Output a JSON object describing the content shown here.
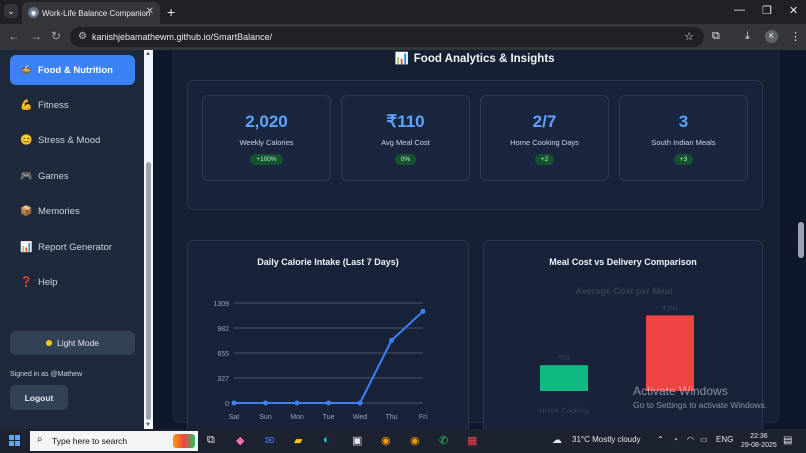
{
  "browser": {
    "tab_title": "Work-Life Balance Companion",
    "url": "kanishjebamathewm.github.io/SmartBalance/",
    "new_tab_symbol": "+",
    "close_tab_symbol": "✕"
  },
  "sidebar": {
    "items": [
      {
        "label": "Food & Nutrition",
        "icon": "food-icon",
        "glyph": "🍲",
        "active": true
      },
      {
        "label": "Fitness",
        "icon": "flexed-arm-icon",
        "glyph": "💪"
      },
      {
        "label": "Stress & Mood",
        "icon": "face-icon",
        "glyph": "😊"
      },
      {
        "label": "Games",
        "icon": "gamepad-icon",
        "glyph": "🎮"
      },
      {
        "label": "Memories",
        "icon": "photo-box-icon",
        "glyph": "📦"
      },
      {
        "label": "Report Generator",
        "icon": "chart-icon",
        "glyph": "📊"
      },
      {
        "label": "Help",
        "icon": "question-icon",
        "glyph": "❓"
      }
    ],
    "mode_button": "Light Mode",
    "signed_in": "Signed in as @Mathew",
    "logout": "Logout"
  },
  "section": {
    "title": "Food Analytics & Insights",
    "icon": "bar-chart-icon"
  },
  "stats": [
    {
      "value": "2,020",
      "label": "Weekly Calories",
      "badge": "+100%"
    },
    {
      "value": "₹110",
      "label": "Avg Meal Cost",
      "badge": "0%"
    },
    {
      "value": "2/7",
      "label": "Home Cooking Days",
      "badge": "+2"
    },
    {
      "value": "3",
      "label": "South Indian Meals",
      "badge": "+3"
    }
  ],
  "charts": {
    "calorie_title": "Daily Calorie Intake (Last 7 Days)",
    "cost_title": "Meal Cost vs Delivery Comparison",
    "cost_subtitle": "Average Cost per Meal",
    "cost_labels": [
      "₹56",
      "₹164"
    ],
    "cost_bar_names": [
      "Home Cooking",
      ""
    ]
  },
  "chart_data": [
    {
      "type": "line",
      "title": "Daily Calorie Intake (Last 7 Days)",
      "x": [
        "Sat",
        "Sun",
        "Mon",
        "Tue",
        "Wed",
        "Thu",
        "Fri"
      ],
      "y_ticks": [
        0,
        327,
        655,
        982,
        1309
      ],
      "ylim": [
        0,
        1309
      ],
      "series": [
        {
          "values": [
            0,
            0,
            0,
            0,
            0,
            820,
            1200
          ]
        }
      ],
      "color": "#3b82f6",
      "grid": true
    },
    {
      "type": "bar",
      "title": "Average Cost per Meal",
      "categories": [
        "Home Cooking",
        ""
      ],
      "values": [
        56,
        164
      ],
      "colors": [
        "#10b981",
        "#ef4444"
      ],
      "ylim": [
        0,
        180
      ]
    }
  ],
  "watermark": {
    "line1": "Activate Windows",
    "line2": "Go to Settings to activate Windows."
  },
  "taskbar": {
    "search_placeholder": "Type here to search",
    "weather": "31°C  Mostly cloudy",
    "lang": "ENG",
    "time": "22:36",
    "date": "29-08-2025"
  }
}
